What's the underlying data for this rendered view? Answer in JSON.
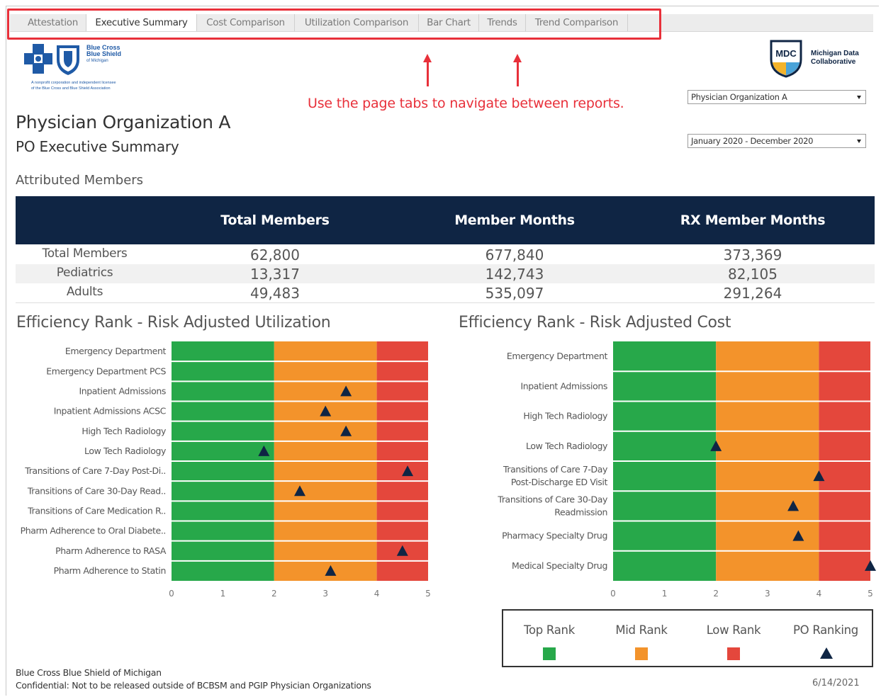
{
  "tabs": [
    {
      "label": "Attestation",
      "active": false
    },
    {
      "label": "Executive Summary",
      "active": true
    },
    {
      "label": "Cost Comparison",
      "active": false
    },
    {
      "label": "Utilization Comparison",
      "active": false
    },
    {
      "label": "Bar Chart",
      "active": false
    },
    {
      "label": "Trends",
      "active": false
    },
    {
      "label": "Trend Comparison",
      "active": false
    }
  ],
  "annotation": "Use the page tabs to navigate between reports.",
  "logos": {
    "bcbs_name_line1": "Blue Cross",
    "bcbs_name_line2": "Blue Shield",
    "bcbs_name_line3": "of Michigan",
    "bcbs_tagline_line1": "A nonprofit corporation and independent licensee",
    "bcbs_tagline_line2": "of the Blue Cross and Blue Shield Association",
    "mdc_badge": "MDC",
    "mdc_name_line1": "Michigan Data",
    "mdc_name_line2": "Collaborative"
  },
  "filters": {
    "organization": "Physician Organization A",
    "date_range": "January 2020 - December 2020"
  },
  "header": {
    "title": "Physician Organization A",
    "subtitle": "PO Executive Summary"
  },
  "members": {
    "section_label": "Attributed Members",
    "columns": [
      "Total Members",
      "Member Months",
      "RX Member Months"
    ],
    "rows": [
      {
        "label": "Total Members",
        "values": [
          "62,800",
          "677,840",
          "373,369"
        ]
      },
      {
        "label": "Pediatrics",
        "values": [
          "13,317",
          "142,743",
          "82,105"
        ]
      },
      {
        "label": "Adults",
        "values": [
          "49,483",
          "535,097",
          "291,264"
        ]
      }
    ]
  },
  "colors": {
    "top_rank": "#27a84a",
    "mid_rank": "#f3932b",
    "low_rank": "#e4473c",
    "po_marker": "#0f2544",
    "header_bg": "#0f2544",
    "annotation_red": "#e8303a"
  },
  "chart_data": [
    {
      "type": "scatter",
      "title": "Efficiency Rank - Risk Adjusted Utilization",
      "xlim": [
        0,
        5
      ],
      "x_ticks": [
        "0",
        "1",
        "2",
        "3",
        "4",
        "5"
      ],
      "bands": [
        {
          "name": "Top Rank",
          "from": 0,
          "to": 2
        },
        {
          "name": "Mid Rank",
          "from": 2,
          "to": 4
        },
        {
          "name": "Low Rank",
          "from": 4,
          "to": 5
        }
      ],
      "categories": [
        "Emergency Department",
        "Emergency Department PCS",
        "Inpatient Admissions",
        "Inpatient Admissions ACSC",
        "High Tech Radiology",
        "Low Tech Radiology",
        "Transitions of Care 7-Day Post-Di..",
        "Transitions of Care 30-Day Read..",
        "Transitions of Care Medication R..",
        "Pharm Adherence to Oral Diabete..",
        "Pharm Adherence to RASA",
        "Pharm Adherence to Statin"
      ],
      "values": [
        null,
        null,
        3.4,
        3.0,
        3.4,
        1.8,
        4.6,
        2.5,
        null,
        null,
        4.5,
        3.1
      ]
    },
    {
      "type": "scatter",
      "title": "Efficiency Rank - Risk Adjusted Cost",
      "xlim": [
        0,
        5
      ],
      "x_ticks": [
        "0",
        "1",
        "2",
        "3",
        "4",
        "5"
      ],
      "bands": [
        {
          "name": "Top Rank",
          "from": 0,
          "to": 2
        },
        {
          "name": "Mid Rank",
          "from": 2,
          "to": 4
        },
        {
          "name": "Low Rank",
          "from": 4,
          "to": 5
        }
      ],
      "categories": [
        [
          "Emergency Department"
        ],
        [
          "Inpatient Admissions"
        ],
        [
          "High Tech Radiology"
        ],
        [
          "Low Tech Radiology"
        ],
        [
          "Transitions of Care 7-Day",
          "Post-Discharge ED Visit"
        ],
        [
          "Transitions of Care 30-Day",
          "Readmission"
        ],
        [
          "Pharmacy Specialty Drug"
        ],
        [
          "Medical Specialty Drug"
        ]
      ],
      "values": [
        null,
        null,
        null,
        2.0,
        4.0,
        3.5,
        3.6,
        5.0
      ]
    }
  ],
  "legend": {
    "items": [
      "Top Rank",
      "Mid Rank",
      "Low Rank",
      "PO Ranking"
    ]
  },
  "footer": {
    "org": "Blue Cross Blue Shield of Michigan",
    "confidential": "Confidential: Not to be released outside of BCBSM and PGIP Physician Organizations",
    "date": "6/14/2021"
  }
}
